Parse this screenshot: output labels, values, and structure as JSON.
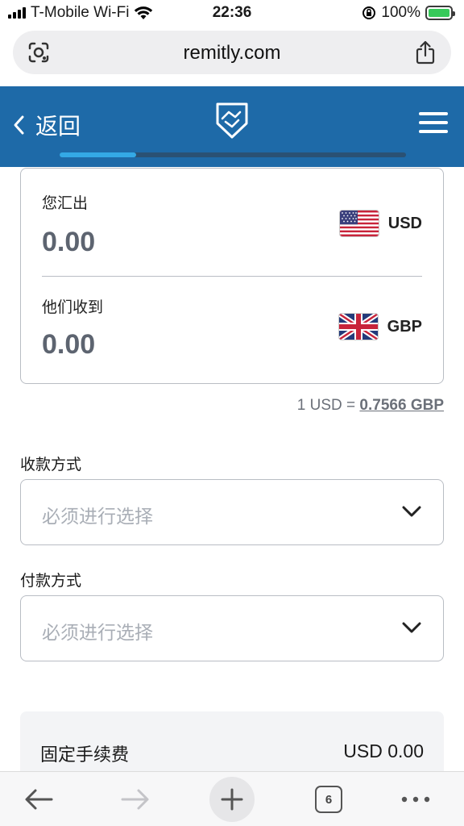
{
  "status_bar": {
    "carrier": "T-Mobile Wi-Fi",
    "time": "22:36",
    "battery": "100%"
  },
  "browser": {
    "url": "remitly.com",
    "tab_count": "6"
  },
  "header": {
    "back_label": "返回",
    "progress": 0.22,
    "colors": {
      "background": "#1e6aa8",
      "progress_fill": "#34a9e6"
    }
  },
  "amount_card": {
    "send_label": "您汇出",
    "send_value": "0.00",
    "send_currency": "USD",
    "receive_label": "他们收到",
    "receive_value": "0.00",
    "receive_currency": "GBP"
  },
  "rate": {
    "prefix": "1 USD =",
    "value": "0.7566 GBP"
  },
  "delivery": {
    "label": "收款方式",
    "placeholder": "必须进行选择"
  },
  "payment": {
    "label": "付款方式",
    "placeholder": "必须进行选择"
  },
  "fee": {
    "label": "固定手续费",
    "value": "USD 0.00"
  },
  "icons": [
    "scan-icon",
    "share-icon",
    "back-chevron-icon",
    "remitly-logo-icon",
    "hamburger-menu-icon",
    "us-flag-icon",
    "uk-flag-icon",
    "chevron-down-icon",
    "arrow-left-icon",
    "arrow-right-icon",
    "plus-icon",
    "more-icon"
  ]
}
